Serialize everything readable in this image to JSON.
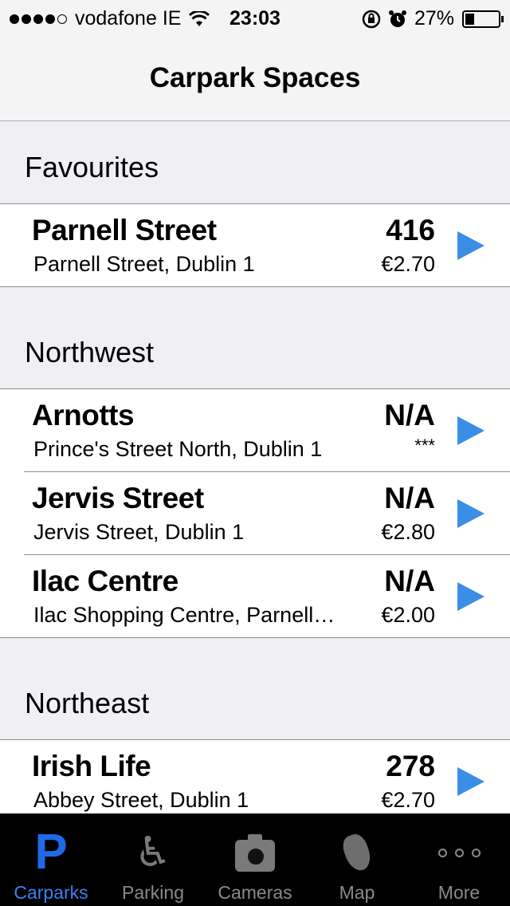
{
  "status_bar": {
    "carrier": "vodafone IE",
    "time": "23:03",
    "battery": "27%",
    "battery_level": 0.27,
    "icons": [
      "signal-dots-icon",
      "wifi-icon",
      "orientation-lock-icon",
      "alarm-icon",
      "battery-icon"
    ]
  },
  "nav": {
    "title": "Carpark Spaces"
  },
  "sections": [
    {
      "header": "Favourites",
      "rows": [
        {
          "name": "Parnell Street",
          "address": "Parnell Street, Dublin 1",
          "spaces": "416",
          "price": "€2.70"
        }
      ]
    },
    {
      "header": "Northwest",
      "rows": [
        {
          "name": "Arnotts",
          "address": "Prince's Street North, Dublin 1",
          "spaces": "N/A",
          "price": "***"
        },
        {
          "name": "Jervis Street",
          "address": "Jervis Street, Dublin 1",
          "spaces": "N/A",
          "price": "€2.80"
        },
        {
          "name": "Ilac Centre",
          "address": "Ilac Shopping Centre, Parnell…",
          "spaces": "N/A",
          "price": "€2.00"
        }
      ]
    },
    {
      "header": "Northeast",
      "rows": [
        {
          "name": "Irish Life",
          "address": "Abbey Street, Dublin 1",
          "spaces": "278",
          "price": "€2.70"
        }
      ]
    }
  ],
  "tab_bar": {
    "tabs": [
      {
        "label": "Carparks",
        "icon": "parking-p-icon",
        "active": true
      },
      {
        "label": "Parking",
        "icon": "wheelchair-icon",
        "active": false
      },
      {
        "label": "Cameras",
        "icon": "camera-icon",
        "active": false
      },
      {
        "label": "Map",
        "icon": "map-pin-icon",
        "active": false
      },
      {
        "label": "More",
        "icon": "more-dots-icon",
        "active": false
      }
    ]
  },
  "colors": {
    "accent": "#3d7ff0",
    "arrow": "#3a8ee6",
    "tab_bg": "#000000"
  }
}
